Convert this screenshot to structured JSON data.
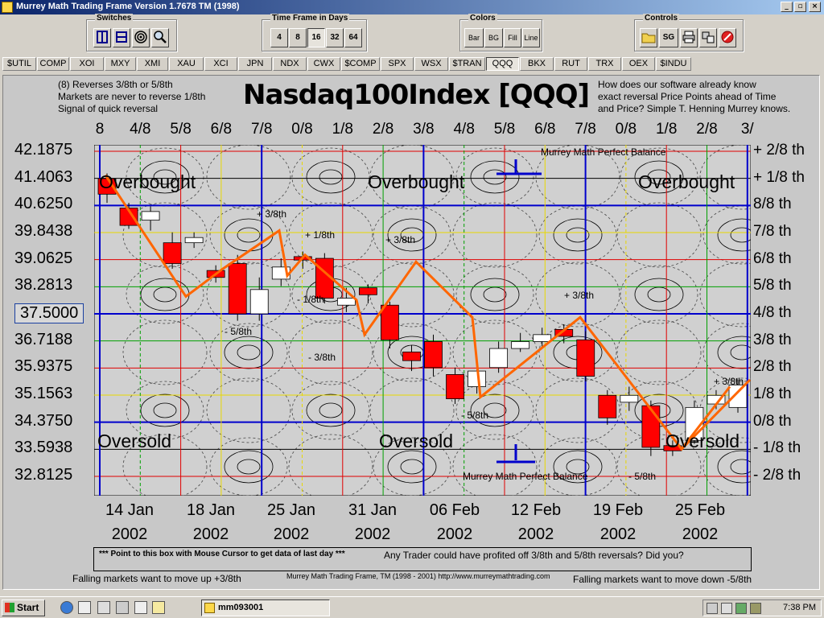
{
  "window": {
    "title": "Murrey Math Trading Frame Version 1.7678  TM (1998)",
    "controls": [
      "_",
      "▫",
      "×"
    ]
  },
  "toolbar": {
    "switches": {
      "label": "Switches",
      "icons": [
        "sync-icon",
        "frame-icon",
        "target-icon",
        "zoom-icon"
      ]
    },
    "timeframe": {
      "label": "Time Frame in Days",
      "options": [
        "4",
        "8",
        "16",
        "32",
        "64"
      ],
      "selected": "16"
    },
    "colors": {
      "label": "Colors",
      "options": [
        "Bar",
        "BG",
        "Fill",
        "Line"
      ]
    },
    "controls": {
      "label": "Controls",
      "buttons": [
        "open-icon",
        "SG",
        "print-icon",
        "setup-icon",
        "exit-icon"
      ],
      "sg_label": "SG"
    }
  },
  "symbol_tabs": [
    "$UTIL",
    "COMP",
    "XOI",
    "MXY",
    "XMI",
    "XAU",
    "XCI",
    "JPN",
    "NDX",
    "CWX",
    "$COMP",
    "SPX",
    "WSX",
    "$TRAN",
    "QQQ",
    "BKX",
    "RUT",
    "TRX",
    "OEX",
    "$INDU"
  ],
  "active_tab": "QQQ",
  "header": {
    "left_note": [
      "(8) Reverses 3/8th or 5/8th",
      "Markets are never to reverse 1/8th",
      "Signal of quick reversal"
    ],
    "title": "Nasdaq100Index [QQQ]",
    "right_note": [
      "How does our software already know",
      "exact reversal Price Points ahead of Time",
      "and Price? Simple T. Henning Murrey knows."
    ]
  },
  "time_fractions": [
    "8",
    "4/8",
    "5/8",
    "6/8",
    "7/8",
    "0/8",
    "1/8",
    "2/8",
    "3/8",
    "4/8",
    "5/8",
    "6/8",
    "7/8",
    "0/8",
    "1/8",
    "2/8",
    "3/"
  ],
  "price_labels": [
    "42.1875",
    "41.4063",
    "40.6250",
    "39.8438",
    "39.0625",
    "38.2813",
    "37.5000",
    "36.7188",
    "35.9375",
    "35.1563",
    "34.3750",
    "33.5938",
    "32.8125"
  ],
  "selected_price": "37.5000",
  "eighth_labels": [
    "+ 2/8 th",
    "+ 1/8 th",
    "8/8 th",
    "7/8 th",
    "6/8 th",
    "5/8 th",
    "4/8 th",
    "3/8 th",
    "2/8 th",
    "1/8 th",
    "0/8 th",
    "- 1/8 th",
    "- 2/8 th"
  ],
  "date_labels": [
    {
      "day": "14 Jan",
      "year": "2002"
    },
    {
      "day": "18 Jan",
      "year": "2002"
    },
    {
      "day": "25 Jan",
      "year": "2002"
    },
    {
      "day": "31 Jan",
      "year": "2002"
    },
    {
      "day": "06 Feb",
      "year": "2002"
    },
    {
      "day": "12 Feb",
      "year": "2002"
    },
    {
      "day": "19 Feb",
      "year": "2002"
    },
    {
      "day": "25 Feb",
      "year": "2002"
    }
  ],
  "chart_text": {
    "overbought": "Overbought",
    "oversold": "Oversold",
    "perfect_balance": "Murrey Math Perfect Balance",
    "annotations": [
      "+ 3/8th",
      "+ 1/8th",
      "+ 3/8th",
      "- 1/8th",
      "- 5/8th",
      "- 3/8th",
      "- 5/8th",
      "+ 3/8th",
      "- 5/8th",
      "+ 3/8th"
    ]
  },
  "chart_data": {
    "type": "candlestick",
    "ylim": [
      32.8125,
      42.1875
    ],
    "candles": [
      {
        "open": 41.4,
        "close": 40.95,
        "high": 41.55,
        "low": 40.7
      },
      {
        "open": 40.55,
        "close": 40.05,
        "high": 40.7,
        "low": 39.95
      },
      {
        "open": 40.2,
        "close": 40.45,
        "high": 40.6,
        "low": 39.9
      },
      {
        "open": 39.55,
        "close": 38.95,
        "high": 39.85,
        "low": 38.8
      },
      {
        "open": 39.55,
        "close": 39.7,
        "high": 39.85,
        "low": 39.4
      },
      {
        "open": 38.75,
        "close": 38.55,
        "high": 38.9,
        "low": 38.4
      },
      {
        "open": 38.95,
        "close": 37.5,
        "high": 39.2,
        "low": 37.3
      },
      {
        "open": 37.5,
        "close": 38.2,
        "high": 38.55,
        "low": 37.3
      },
      {
        "open": 38.5,
        "close": 38.85,
        "high": 39.1,
        "low": 38.3
      },
      {
        "open": 39.15,
        "close": 39.05,
        "high": 39.3,
        "low": 38.8
      },
      {
        "open": 39.1,
        "close": 37.95,
        "high": 39.25,
        "low": 37.8
      },
      {
        "open": 37.75,
        "close": 37.95,
        "high": 38.25,
        "low": 37.55
      },
      {
        "open": 38.25,
        "close": 38.05,
        "high": 38.35,
        "low": 37.8
      },
      {
        "open": 37.75,
        "close": 36.75,
        "high": 37.85,
        "low": 36.5
      },
      {
        "open": 36.4,
        "close": 36.15,
        "high": 36.6,
        "low": 35.85
      },
      {
        "open": 36.7,
        "close": 35.95,
        "high": 36.9,
        "low": 35.7
      },
      {
        "open": 35.75,
        "close": 35.05,
        "high": 35.95,
        "low": 34.9
      },
      {
        "open": 35.4,
        "close": 35.85,
        "high": 35.95,
        "low": 35.2
      },
      {
        "open": 35.95,
        "close": 36.5,
        "high": 36.7,
        "low": 35.8
      },
      {
        "open": 36.5,
        "close": 36.7,
        "high": 36.95,
        "low": 36.4
      },
      {
        "open": 36.7,
        "close": 36.9,
        "high": 37.1,
        "low": 36.55
      },
      {
        "open": 37.05,
        "close": 36.85,
        "high": 37.2,
        "low": 36.65
      },
      {
        "open": 36.75,
        "close": 35.7,
        "high": 37.0,
        "low": 35.55
      },
      {
        "open": 35.15,
        "close": 34.5,
        "high": 35.3,
        "low": 34.3
      },
      {
        "open": 34.95,
        "close": 35.15,
        "high": 35.4,
        "low": 34.7
      },
      {
        "open": 34.85,
        "close": 33.65,
        "high": 35.0,
        "low": 33.4
      },
      {
        "open": 33.7,
        "close": 33.55,
        "high": 33.85,
        "low": 33.4
      },
      {
        "open": 33.85,
        "close": 34.8,
        "high": 35.0,
        "low": 33.75
      },
      {
        "open": 34.9,
        "close": 35.15,
        "high": 35.3,
        "low": 34.75
      },
      {
        "open": 34.8,
        "close": 35.45,
        "high": 35.6,
        "low": 34.65
      }
    ],
    "reversal_line": [
      41.5,
      38.0,
      38.8,
      39.9,
      38.6,
      39.2,
      37.9,
      36.9,
      39.0,
      37.4,
      35.1,
      37.4,
      33.6,
      35.4
    ],
    "colors": {
      "down": "#ff0000",
      "up": "#ffffff",
      "reversal": "#ff6600",
      "frame_blue": "#0000cc",
      "frame_red": "#e00000",
      "frame_green": "#00a000",
      "frame_yellow": "#e8d800"
    }
  },
  "footer": {
    "databox_left": "*** Point to this box with Mouse Cursor to get data of last day ***",
    "databox_right": "Any Trader could have profited off 3/8th and 5/8th reversals? Did you?",
    "left": "Falling markets want to move up +3/8th",
    "center": "Murrey Math Trading Frame, TM (1998 - 2001) http://www.murreymathtrading.com",
    "right": "Falling markets want to move down -5/8th"
  },
  "taskbar": {
    "start": "Start",
    "task": "mm093001",
    "clock": "7:38 PM"
  }
}
